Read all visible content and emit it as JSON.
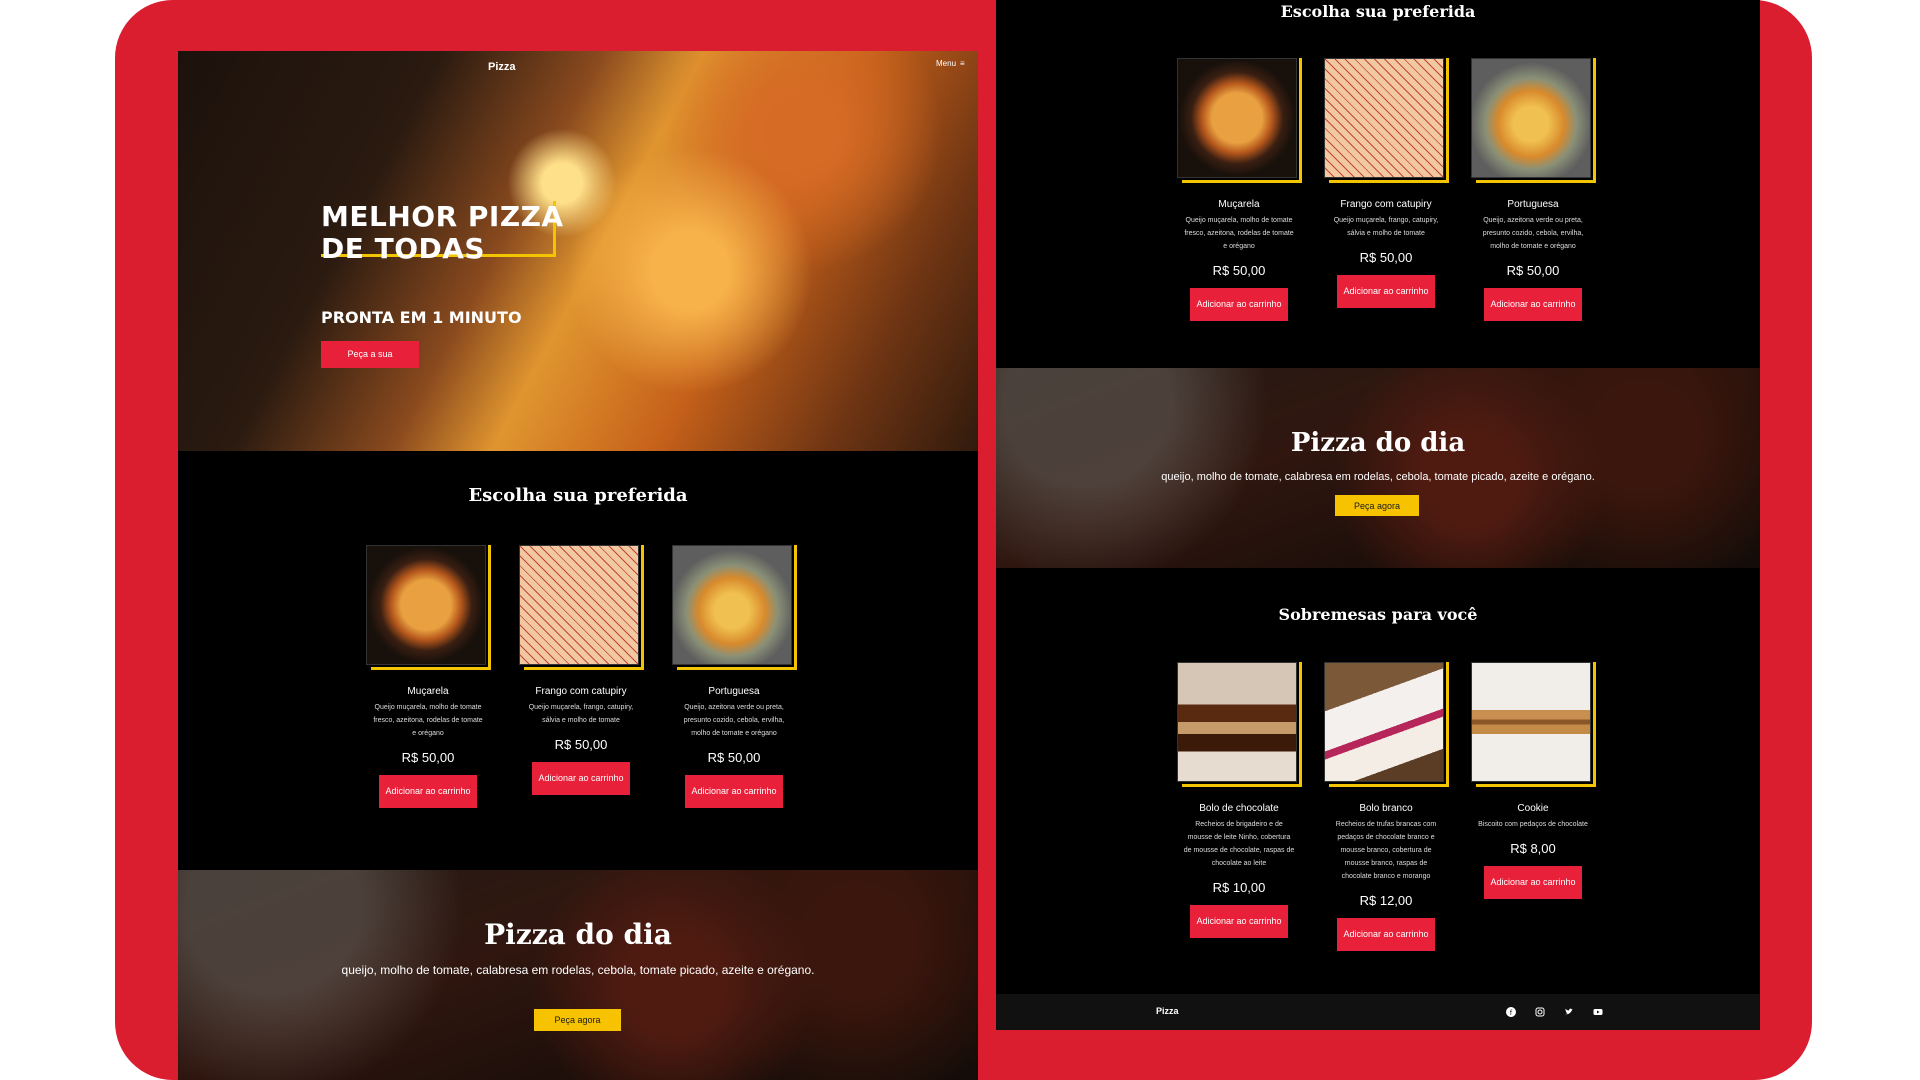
{
  "brand": "Pizza",
  "menu_label": "Menu",
  "hero": {
    "title": "MELHOR PIZZA DE TODAS",
    "subtitle": "PRONTA EM 1 MINUTO",
    "cta": "Peça a sua"
  },
  "pizzas": {
    "title": "Escolha sua preferida",
    "items": [
      {
        "name": "Muçarela",
        "desc": "Queijo muçarela, molho de tomate fresco, azeitona, rodelas de tomate e orégano",
        "price": "R$ 50,00",
        "button": "Adicionar ao carrinho"
      },
      {
        "name": "Frango com catupiry",
        "desc": "Queijo muçarela, frango, catupiry, sálvia e molho de tomate",
        "price": "R$ 50,00",
        "button": "Adicionar ao carrinho"
      },
      {
        "name": "Portuguesa",
        "desc": "Queijo, azeitona verde ou preta, presunto cozido, cebola, ervilha, molho de tomate e orégano",
        "price": "R$ 50,00",
        "button": "Adicionar ao carrinho"
      }
    ]
  },
  "pizza_day": {
    "title": "Pizza do dia",
    "desc": "queijo, molho de tomate, calabresa em rodelas, cebola, tomate picado, azeite e orégano.",
    "cta": "Peça agora"
  },
  "desserts": {
    "title": "Sobremesas para você",
    "items": [
      {
        "name": "Bolo de chocolate",
        "desc": "Recheios de brigadeiro e de mousse de leite Ninho, cobertura de mousse de chocolate, raspas de chocolate ao leite",
        "price": "R$ 10,00",
        "button": "Adicionar ao carrinho"
      },
      {
        "name": "Bolo branco",
        "desc": "Recheios de trufas brancas com pedaços de chocolate branco e mousse branco, cobertura de mousse branco, raspas de chocolate branco e morango",
        "price": "R$ 12,00",
        "button": "Adicionar ao carrinho"
      },
      {
        "name": "Cookie",
        "desc": "Biscoito com pedaços de chocolate",
        "price": "R$ 8,00",
        "button": "Adicionar ao carrinho"
      }
    ]
  },
  "footer": {
    "brand": "Pizza",
    "social": [
      "facebook-icon",
      "instagram-icon",
      "twitter-icon",
      "youtube-icon"
    ]
  },
  "colors": {
    "frame": "#db1d30",
    "accent_red": "#e8203a",
    "accent_yellow": "#f7c300"
  }
}
